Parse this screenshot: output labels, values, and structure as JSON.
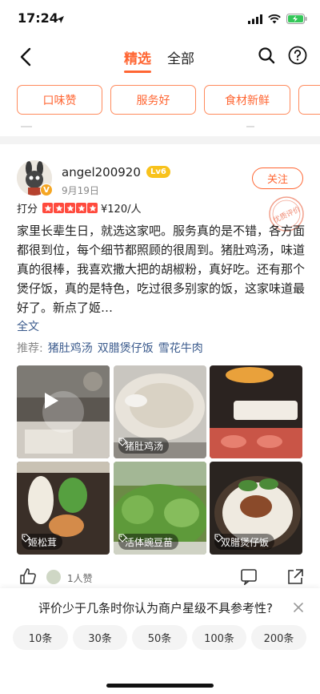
{
  "status": {
    "time": "17:24"
  },
  "nav": {
    "tabs": [
      {
        "label": "精选"
      },
      {
        "label": "全部"
      }
    ]
  },
  "filters": [
    "口味赞",
    "服务好",
    "食材新鲜",
    ""
  ],
  "review": {
    "username": "angel200920",
    "level": "Lv6",
    "vip_badge": "V",
    "date": "9月19日",
    "follow_label": "关注",
    "stamp_text": "优质评价",
    "rating_label": "打分",
    "stars": 5,
    "price": "¥120/人",
    "text": "家里长辈生日，就选这家吧。服务真的是不错，各方面都很到位，每个细节都照顾的很周到。猪肚鸡汤，味道真的很棒，我喜欢撒大把的胡椒粉，真好吃。还有那个煲仔饭，真的是特色，吃过很多别家的饭，这家味道最好了。新点了姬…",
    "more_label": "全文",
    "recommend_label": "推荐:",
    "recommend_dishes": [
      "猪肚鸡汤",
      "双腊煲仔饭",
      "雪花牛肉"
    ],
    "photos": [
      {
        "tag": ""
      },
      {
        "tag": "猪肚鸡汤"
      },
      {
        "tag": ""
      },
      {
        "tag": "姬松茸"
      },
      {
        "tag": "活体豌豆苗"
      },
      {
        "tag": "双腊煲仔饭"
      }
    ],
    "like_count": "1人赞"
  },
  "survey": {
    "question": "评价少于几条时你认为商户星级不具参考性?",
    "options": [
      "10条",
      "30条",
      "50条",
      "100条",
      "200条"
    ]
  },
  "colors": {
    "accent": "#ff6633",
    "link": "#3a5a8c",
    "star": "#ff4a3d"
  }
}
